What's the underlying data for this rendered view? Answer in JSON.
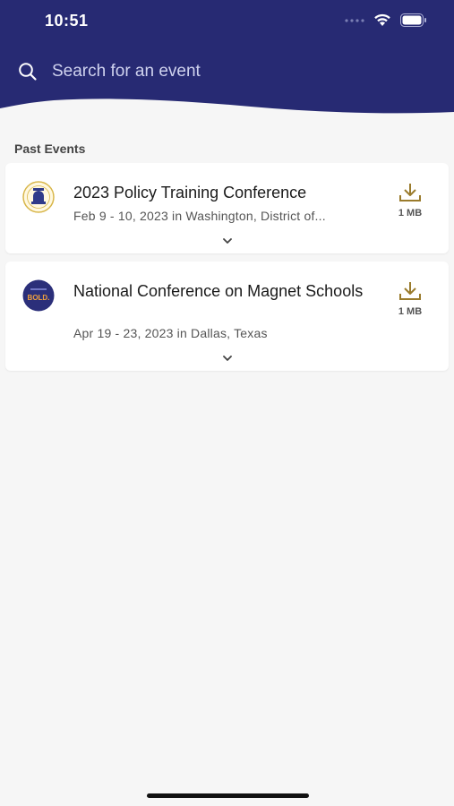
{
  "status_bar": {
    "time": "10:51"
  },
  "search": {
    "placeholder": "Search for an event"
  },
  "section": {
    "title": "Past Events"
  },
  "events": [
    {
      "title": "2023 Policy Training Conference",
      "subtitle": "Feb 9 - 10, 2023 in Washington, District of...",
      "size": "1 MB",
      "logo": "policy-conference-seal"
    },
    {
      "title": "National Conference on Magnet Schools",
      "subtitle": "Apr 19 - 23, 2023 in Dallas, Texas",
      "size": "1 MB",
      "logo": "magnet-schools-bold-logo",
      "logo_text": "BOLD."
    }
  ],
  "colors": {
    "header": "#272a73",
    "accent_gold": "#9a7b2c",
    "background": "#f6f6f6"
  }
}
